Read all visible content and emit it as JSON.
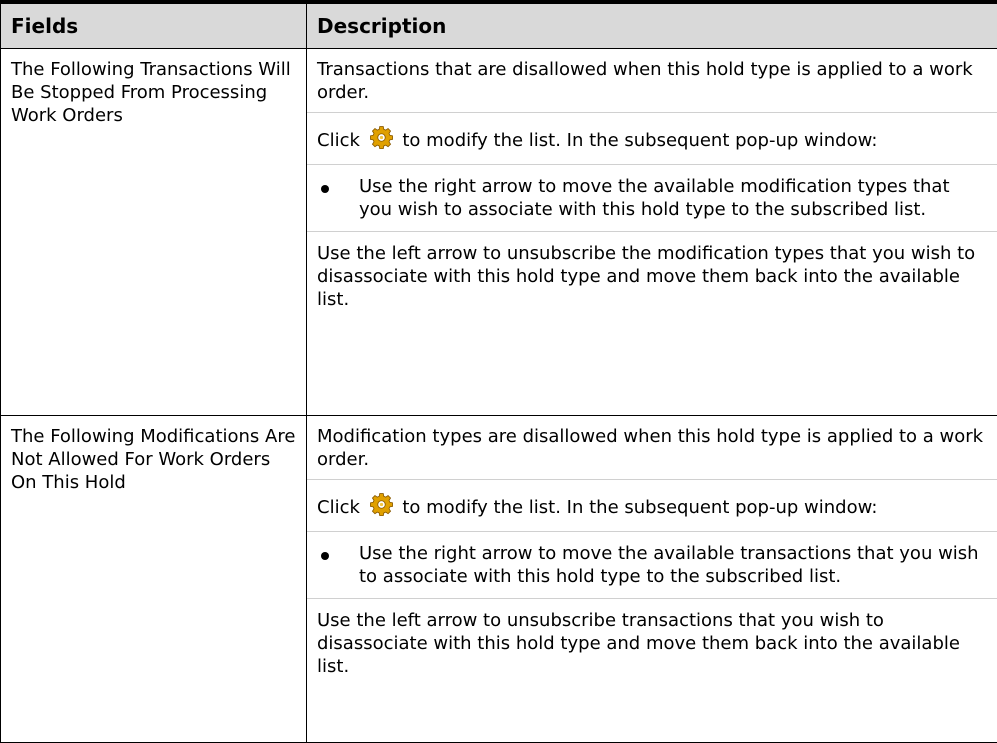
{
  "table": {
    "headers": {
      "fields": "Fields",
      "description": "Description"
    },
    "rows": [
      {
        "field": "The Following Transactions Will Be Stopped From Processing Work Orders",
        "description": {
          "intro": "Transactions that are disallowed when this hold type is applied to a work order.",
          "click_before": "Click",
          "click_after": "to modify the list. In the subsequent pop-up window:",
          "bullet": "Use the right arrow to move the available modification types that you wish to associate with this hold type to the subscribed list.",
          "outro": "Use the left arrow to unsubscribe the modification types that you wish to disassociate with this hold type and move them back into the available list."
        }
      },
      {
        "field": "The Following Modifications Are Not Allowed For Work Orders On This Hold",
        "description": {
          "intro": "Modification types are disallowed when this hold type is applied to a work order.",
          "click_before": "Click",
          "click_after": "to modify the list. In the subsequent pop-up window:",
          "bullet": "Use the right arrow to move the available transactions that you wish to associate with this hold type to the subscribed list.",
          "outro": "Use the left arrow to unsubscribe transactions that you wish to disassociate with this hold type and move them back into the available list."
        }
      }
    ]
  },
  "icons": {
    "modify_list": "gear-icon"
  },
  "colors": {
    "header_background": "#d9d9d9",
    "gear_gold": "#e0a000",
    "gear_dark": "#8a5a00"
  }
}
